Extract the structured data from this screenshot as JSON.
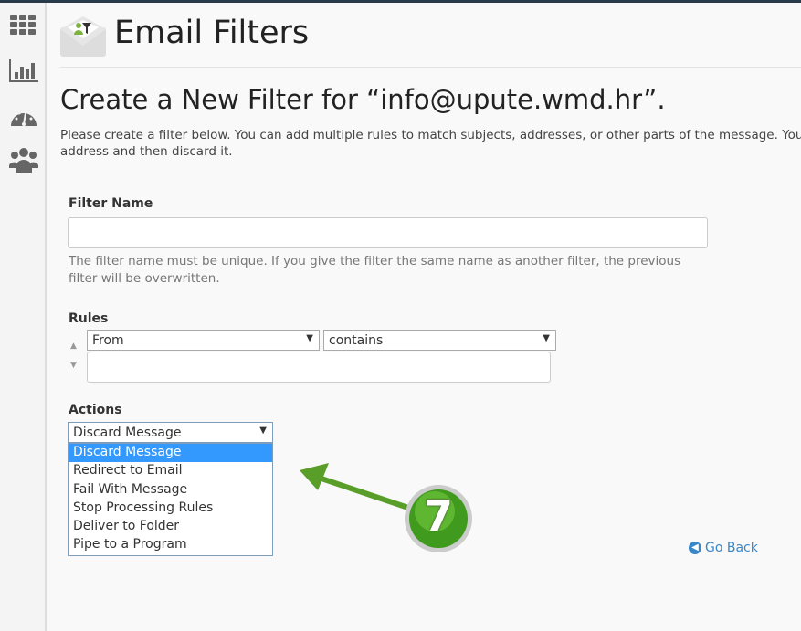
{
  "header": {
    "title": "Email Filters"
  },
  "sidebar": {
    "icons": [
      "grid-icon",
      "bar-chart-icon",
      "dashboard-gauge-icon",
      "users-icon"
    ]
  },
  "page": {
    "heading": "Create a New Filter for “info@upute.wmd.hr”.",
    "intro_line1": "Please create a filter below. You can add multiple rules to match subjects, addresses, or other parts of the message. You ca",
    "intro_line2": "address and then discard it."
  },
  "filter_name": {
    "label": "Filter Name",
    "value": "",
    "help": "The filter name must be unique. If you give the filter the same name as another filter, the previous filter will be overwritten."
  },
  "rules": {
    "label": "Rules",
    "field": "From",
    "operator": "contains",
    "value": ""
  },
  "actions": {
    "label": "Actions",
    "selected": "Discard Message",
    "options": [
      "Discard Message",
      "Redirect to Email",
      "Fail With Message",
      "Stop Processing Rules",
      "Deliver to Folder",
      "Pipe to a Program"
    ]
  },
  "annotation": {
    "step": "7",
    "color": "#5a9e2a"
  },
  "go_back": "Go Back"
}
